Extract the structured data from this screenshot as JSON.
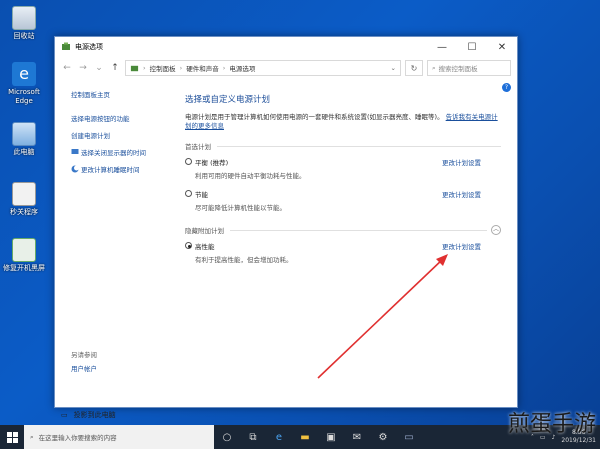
{
  "desktop": {
    "icons": [
      {
        "label": "回收站",
        "icon": "recycle-bin-icon"
      },
      {
        "label": "Microsoft Edge",
        "icon": "edge-icon"
      },
      {
        "label": "此电脑",
        "icon": "computer-icon"
      },
      {
        "label": "秒关程序",
        "icon": "app-icon"
      },
      {
        "label": "修复开机黑屏",
        "icon": "repair-icon"
      }
    ]
  },
  "window": {
    "title": "电源选项",
    "address": {
      "parts": [
        "控制面板",
        "硬件和声音",
        "电源选项"
      ]
    },
    "search_placeholder": "搜索控制面板",
    "help": "?",
    "sidebar": {
      "home": "控制面板主页",
      "items": [
        "选择电源按钮的功能",
        "创建电源计划",
        "选择关闭显示器的时间",
        "更改计算机睡眠时间"
      ],
      "see_also": "另请参阅",
      "user_accounts": "用户帐户"
    },
    "main": {
      "heading": "选择或自定义电源计划",
      "description": "电源计划是用于管理计算机如何使用电源的一套硬件和系统设置(如显示器亮度、睡眠等)。",
      "desc_link": "告诉我有关电源计划的更多信息",
      "preferred_label": "首选计划",
      "hidden_label": "隐藏附加计划",
      "plans": [
        {
          "name": "平衡 (推荐)",
          "desc": "利用可用的硬件自动平衡功耗与性能。",
          "change": "更改计划设置",
          "selected": false
        },
        {
          "name": "节能",
          "desc": "尽可能降低计算机性能以节能。",
          "change": "更改计划设置",
          "selected": false
        },
        {
          "name": "高性能",
          "desc": "有利于提高性能，但会增加功耗。",
          "change": "更改计划设置",
          "selected": true
        }
      ]
    },
    "pin": "投影到此电脑"
  },
  "taskbar": {
    "search_placeholder": "在这里输入你要搜索的内容",
    "clock_time": "8:56",
    "clock_date": "2019/12/31"
  },
  "watermark": "煎蛋手游",
  "colors": {
    "accent": "#1a4f9c",
    "arrow": "#e03030",
    "desktop": "#0b5cc7"
  }
}
